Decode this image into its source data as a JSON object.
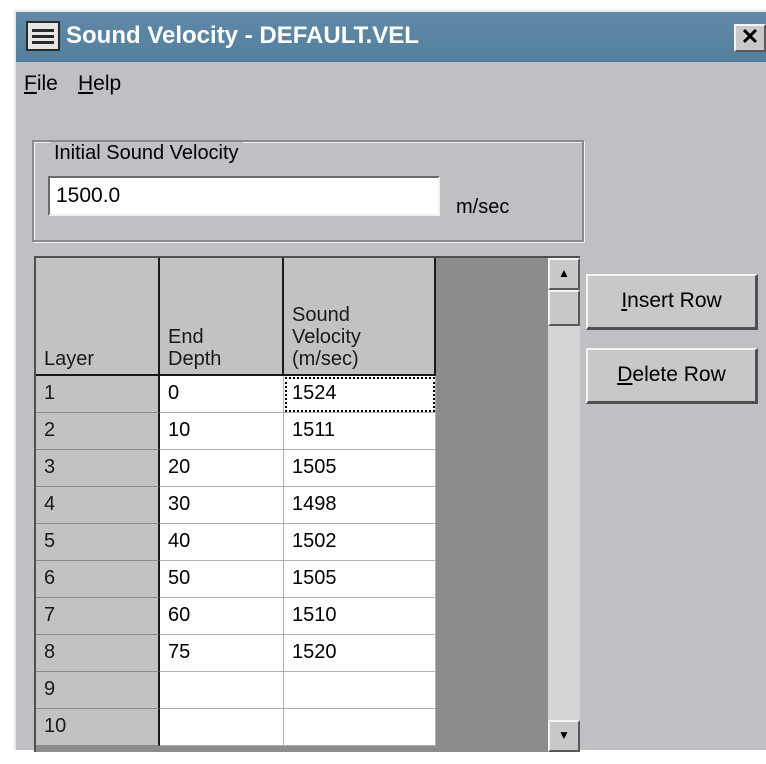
{
  "window": {
    "title": "Sound Velocity - DEFAULT.VEL",
    "close_label": "✕"
  },
  "menu": [
    {
      "label": "File",
      "accel": "F",
      "rest": "ile"
    },
    {
      "label": "Help",
      "accel": "H",
      "rest": "elp"
    }
  ],
  "initial_velocity": {
    "group_label": "Initial Sound Velocity",
    "value": "1500.0",
    "unit": "m/sec"
  },
  "table": {
    "headers": {
      "layer": "Layer",
      "end_depth": "End\nDepth",
      "sound_velocity": "Sound\nVelocity\n(m/sec)"
    },
    "rows": [
      {
        "layer": "1",
        "depth": "0",
        "velocity": "1524"
      },
      {
        "layer": "2",
        "depth": "10",
        "velocity": "1511"
      },
      {
        "layer": "3",
        "depth": "20",
        "velocity": "1505"
      },
      {
        "layer": "4",
        "depth": "30",
        "velocity": "1498"
      },
      {
        "layer": "5",
        "depth": "40",
        "velocity": "1502"
      },
      {
        "layer": "6",
        "depth": "50",
        "velocity": "1505"
      },
      {
        "layer": "7",
        "depth": "60",
        "velocity": "1510"
      },
      {
        "layer": "8",
        "depth": "75",
        "velocity": "1520"
      },
      {
        "layer": "9",
        "depth": "",
        "velocity": ""
      },
      {
        "layer": "10",
        "depth": "",
        "velocity": ""
      }
    ],
    "focused_row": 0
  },
  "buttons": {
    "insert_row": {
      "label": "Insert Row",
      "accel": "I",
      "rest": "nsert Row"
    },
    "delete_row": {
      "label": "Delete Row",
      "accel": "D",
      "rest": "elete Row"
    }
  },
  "icons": {
    "app": "waveform-app-icon",
    "close": "close-icon",
    "scroll_up": "scroll-up-arrow-icon",
    "scroll_down": "scroll-down-arrow-icon"
  },
  "colors": {
    "title_bar": "#5a84a1",
    "window_bg": "#c0c0c4",
    "grid_bg": "#8c8c8c"
  }
}
